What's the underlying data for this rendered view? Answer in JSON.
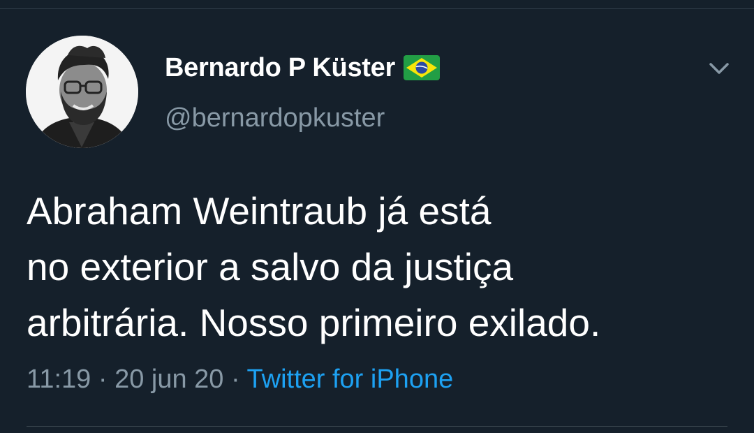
{
  "author": {
    "display_name": "Bernardo P Küster",
    "handle": "@bernardopkuster",
    "flag_icon": "brazil-flag-icon"
  },
  "tweet": {
    "lines": [
      "Abraham Weintraub já está",
      "no exterior a salvo da justiça",
      "arbitrária. Nosso primeiro exilado."
    ],
    "time": "11:19",
    "separator": " · ",
    "date": "20 jun 20",
    "source": "Twitter for iPhone"
  },
  "icons": {
    "menu": "chevron-down-icon"
  },
  "colors": {
    "background": "#15202b",
    "text": "#ffffff",
    "muted": "#8899a6",
    "link": "#1da1f2"
  }
}
